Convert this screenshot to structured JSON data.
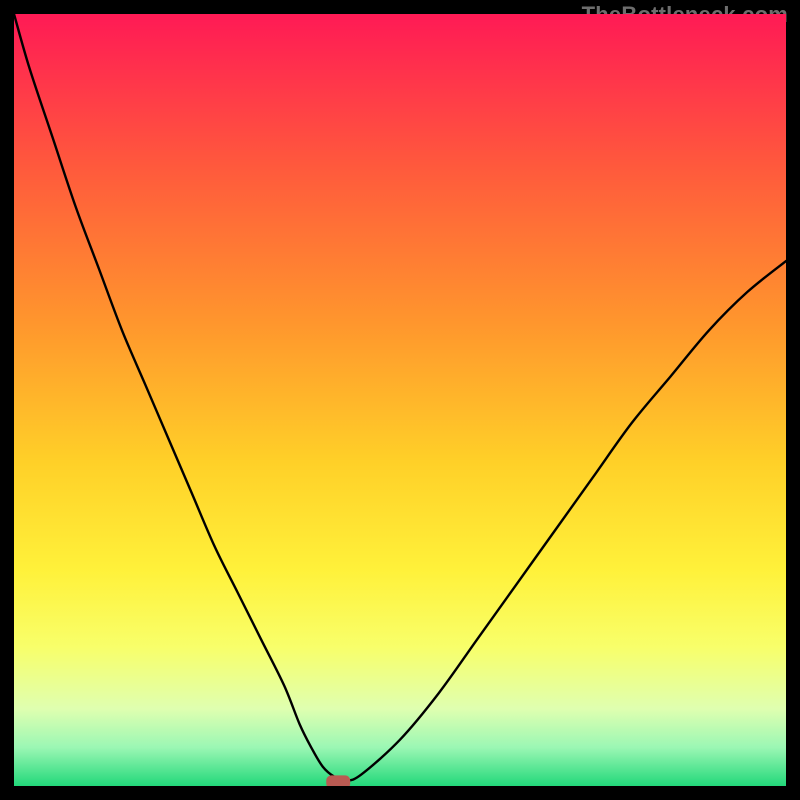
{
  "watermark": "TheBottleneck.com",
  "chart_data": {
    "type": "line",
    "title": "",
    "xlabel": "",
    "ylabel": "",
    "xlim": [
      0,
      100
    ],
    "ylim": [
      0,
      100
    ],
    "x": [
      0,
      2,
      5,
      8,
      11,
      14,
      17,
      20,
      23,
      26,
      29,
      32,
      35,
      37,
      38.5,
      40,
      41.5,
      43,
      45,
      50,
      55,
      60,
      65,
      70,
      75,
      80,
      85,
      90,
      95,
      100
    ],
    "values": [
      100,
      93,
      84,
      75,
      67,
      59,
      52,
      45,
      38,
      31,
      25,
      19,
      13,
      8,
      5,
      2.5,
      1.2,
      0.7,
      1.5,
      6,
      12,
      19,
      26,
      33,
      40,
      47,
      53,
      59,
      64,
      68
    ],
    "marker": {
      "x": 42,
      "y": 0.6
    },
    "gradient_stops": [
      {
        "offset": 0.0,
        "color": "#ff1a55"
      },
      {
        "offset": 0.2,
        "color": "#ff5a3c"
      },
      {
        "offset": 0.4,
        "color": "#ff962d"
      },
      {
        "offset": 0.58,
        "color": "#ffd028"
      },
      {
        "offset": 0.72,
        "color": "#fff13a"
      },
      {
        "offset": 0.82,
        "color": "#f8ff6a"
      },
      {
        "offset": 0.9,
        "color": "#dfffb0"
      },
      {
        "offset": 0.95,
        "color": "#9bf7b4"
      },
      {
        "offset": 1.0,
        "color": "#22d87a"
      }
    ]
  }
}
